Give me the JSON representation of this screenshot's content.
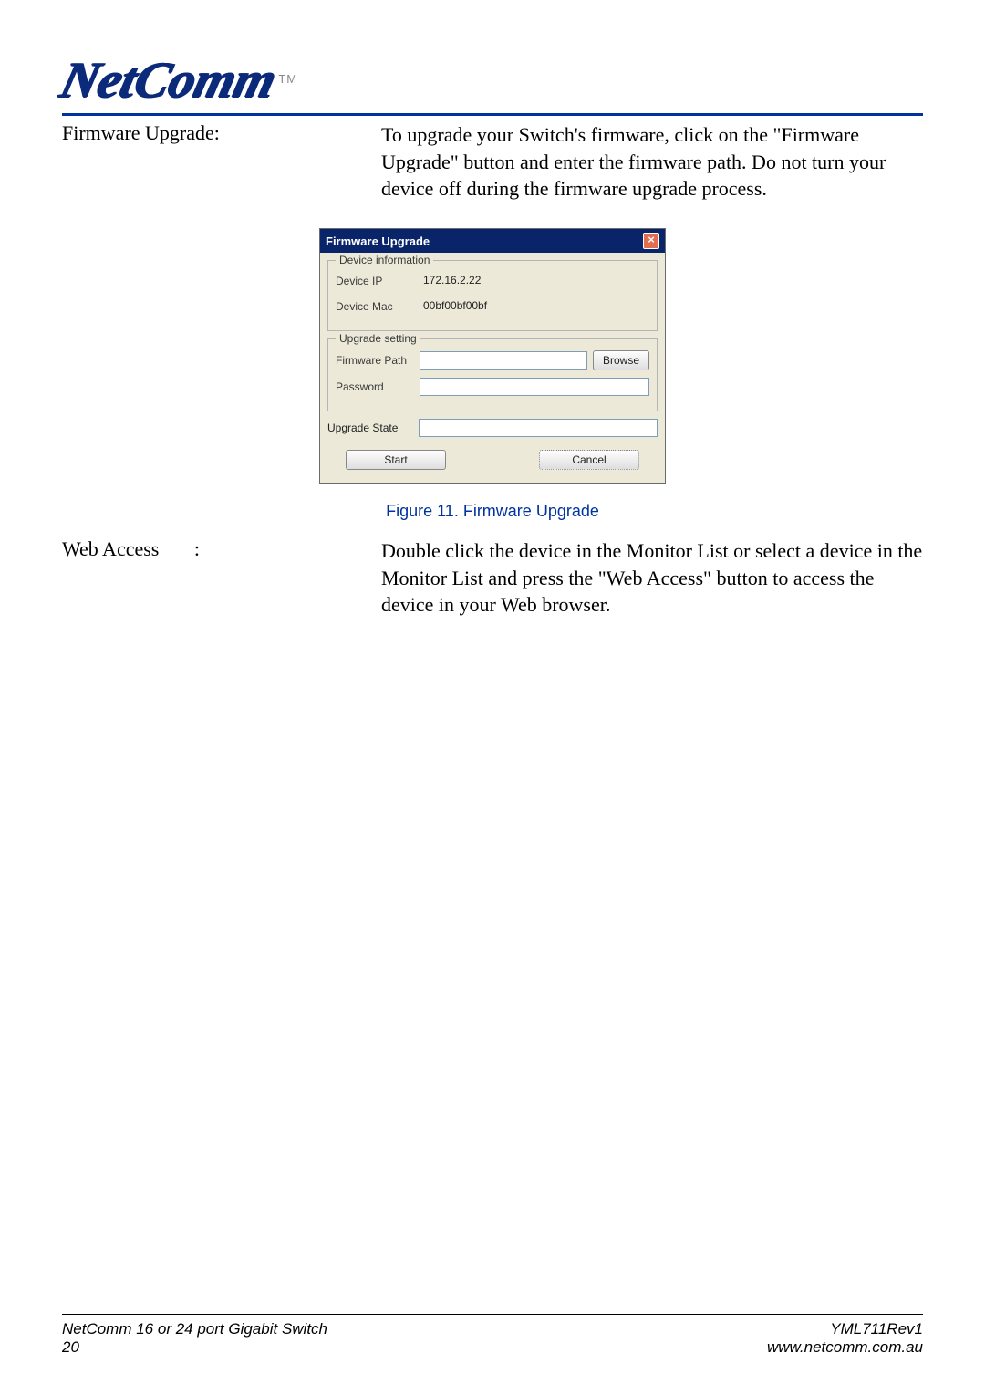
{
  "brand": {
    "name": "NetComm",
    "tm": "TM"
  },
  "sections": [
    {
      "label": "Firmware Upgrade:",
      "body": "To upgrade your Switch's firmware, click on the \"Firmware Upgrade\" button and enter the firmware path. Do not turn your device off during the firmware upgrade process."
    },
    {
      "label": "Web Access       :",
      "body": "Double click the device in the Monitor List or select a device in the Monitor List and press the \"Web Access\" button to access the device in your Web browser."
    }
  ],
  "dialog": {
    "title": "Firmware Upgrade",
    "close": "×",
    "device_info": {
      "legend": "Device information",
      "ip_label": "Device IP",
      "ip_value": "172.16.2.22",
      "mac_label": "Device Mac",
      "mac_value": "00bf00bf00bf"
    },
    "upgrade_setting": {
      "legend": "Upgrade setting",
      "path_label": "Firmware Path",
      "path_value": "",
      "browse_label": "Browse",
      "password_label": "Password",
      "password_value": ""
    },
    "state": {
      "label": "Upgrade State",
      "value": ""
    },
    "buttons": {
      "start": "Start",
      "cancel": "Cancel"
    }
  },
  "figure_caption": "Figure 11. Firmware Upgrade",
  "footer": {
    "left_top": "NetComm 16 or 24 port Gigabit Switch",
    "left_bottom": "20",
    "right_top": "YML711Rev1",
    "right_bottom": "www.netcomm.com.au"
  }
}
